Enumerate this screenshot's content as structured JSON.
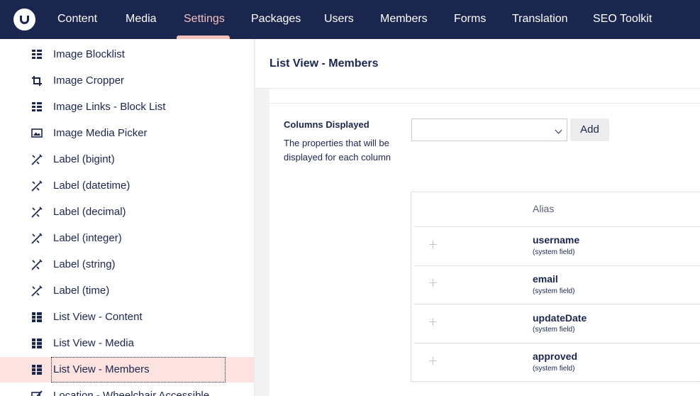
{
  "topnav": {
    "items": [
      {
        "label": "Content"
      },
      {
        "label": "Media"
      },
      {
        "label": "Settings",
        "active": true
      },
      {
        "label": "Packages"
      },
      {
        "label": "Users"
      },
      {
        "label": "Members"
      },
      {
        "label": "Forms"
      },
      {
        "label": "Translation"
      },
      {
        "label": "SEO Toolkit"
      }
    ],
    "active_color": "#f5c1bc",
    "background": "#1b264f"
  },
  "sidebar": {
    "items": [
      {
        "label": "Image Blocklist",
        "icon": "block-list-icon"
      },
      {
        "label": "Image Cropper",
        "icon": "crop-icon"
      },
      {
        "label": "Image Links - Block List",
        "icon": "block-list-icon"
      },
      {
        "label": "Image Media Picker",
        "icon": "picture-icon"
      },
      {
        "label": "Label (bigint)",
        "icon": "label-icon"
      },
      {
        "label": "Label (datetime)",
        "icon": "label-icon"
      },
      {
        "label": "Label (decimal)",
        "icon": "label-icon"
      },
      {
        "label": "Label (integer)",
        "icon": "label-icon"
      },
      {
        "label": "Label (string)",
        "icon": "label-icon"
      },
      {
        "label": "Label (time)",
        "icon": "label-icon"
      },
      {
        "label": "List View - Content",
        "icon": "list-view-icon"
      },
      {
        "label": "List View - Media",
        "icon": "list-view-icon"
      },
      {
        "label": "List View - Members",
        "icon": "list-view-icon",
        "selected": true
      },
      {
        "label": "Location - Wheelchair Accessible",
        "icon": "checkbox-icon"
      }
    ]
  },
  "editor": {
    "title": "List View - Members"
  },
  "property": {
    "label": "Columns Displayed",
    "description": "The properties that will be displayed for each column",
    "select_value": "",
    "add_label": "Add"
  },
  "columns_table": {
    "header_alias": "Alias",
    "rows": [
      {
        "alias": "username",
        "note": "(system field)"
      },
      {
        "alias": "email",
        "note": "(system field)"
      },
      {
        "alias": "updateDate",
        "note": "(system field)"
      },
      {
        "alias": "approved",
        "note": "(system field)"
      }
    ]
  }
}
